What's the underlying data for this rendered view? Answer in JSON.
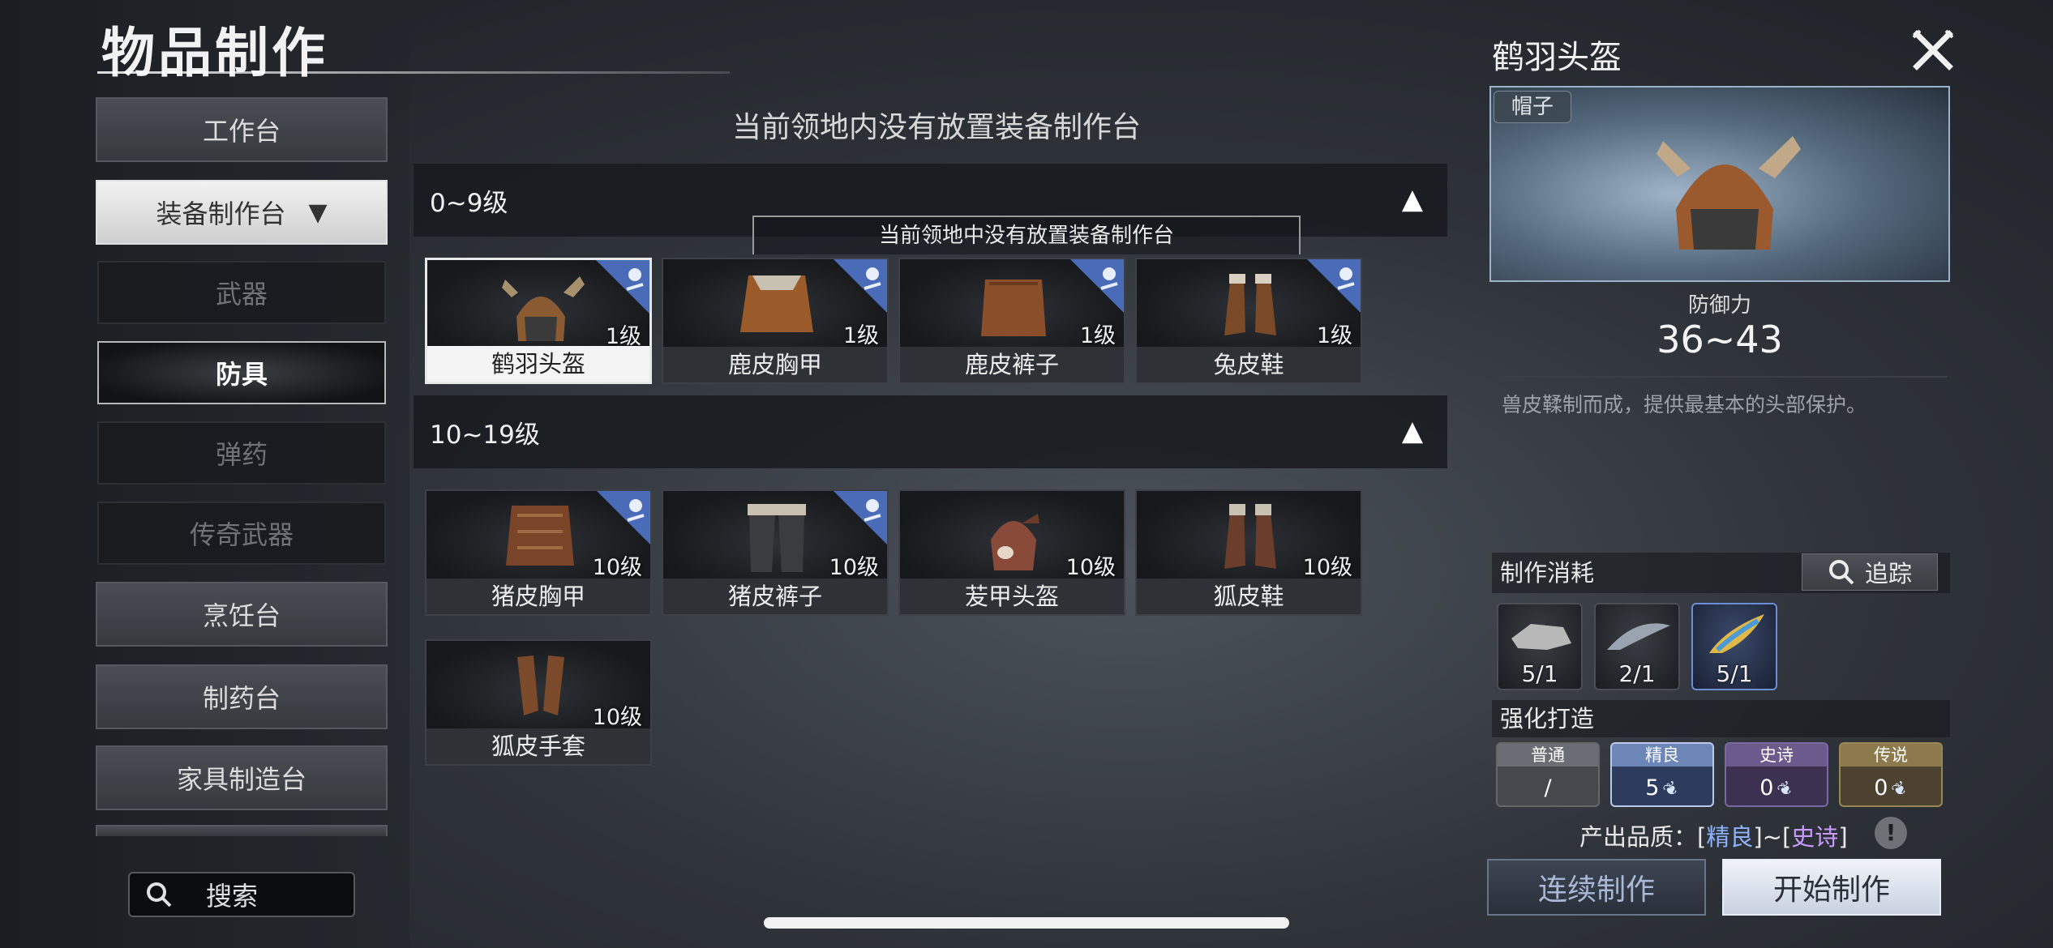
{
  "header": {
    "title": "物品制作"
  },
  "sidebar": {
    "categories": {
      "workbench": "工作台",
      "equipment_bench": "装备制作台",
      "cooking": "烹饪台",
      "pharmacy": "制药台",
      "furniture": "家具制造台"
    },
    "sub_items": {
      "weapons": "武器",
      "armor": "防具",
      "ammo": "弹药",
      "legendary": "传奇武器"
    },
    "search_label": "搜索"
  },
  "main": {
    "notice": "当前领地内没有放置装备制作台",
    "tooltip": "当前领地中没有放置装备制作台",
    "sections": [
      {
        "title": "0~9级",
        "items": [
          {
            "name": "鹤羽头盔",
            "level": "1级"
          },
          {
            "name": "鹿皮胸甲",
            "level": "1级"
          },
          {
            "name": "鹿皮裤子",
            "level": "1级"
          },
          {
            "name": "兔皮鞋",
            "level": "1级"
          }
        ]
      },
      {
        "title": "10~19级",
        "items": [
          {
            "name": "猪皮胸甲",
            "level": "10级"
          },
          {
            "name": "猪皮裤子",
            "level": "10级"
          },
          {
            "name": "苃甲头盔",
            "level": "10级"
          },
          {
            "name": "狐皮鞋",
            "level": "10级"
          },
          {
            "name": "狐皮手套",
            "level": "10级"
          }
        ]
      }
    ]
  },
  "detail": {
    "title": "鹤羽头盔",
    "type_tag": "帽子",
    "defense_label": "防御力",
    "defense_value": "36~43",
    "description": "兽皮鞣制而成，提供最基本的头部保护。",
    "materials_label": "制作消耗",
    "track_label": "追踪",
    "materials": [
      {
        "count": "5/1"
      },
      {
        "count": "2/1"
      },
      {
        "count": "5/1"
      }
    ],
    "enhance_label": "强化打造",
    "qualities": [
      {
        "name": "普通",
        "value": "/"
      },
      {
        "name": "精良",
        "value": "5"
      },
      {
        "name": "史诗",
        "value": "0"
      },
      {
        "name": "传说",
        "value": "0"
      }
    ],
    "output_prefix": "产出品质：",
    "output_open1": "[",
    "output_fine": "精良",
    "output_mid": "]~[",
    "output_epic": "史诗",
    "output_close": "]",
    "info_label": "!",
    "continue_label": "连续制作",
    "start_label": "开始制作"
  },
  "colors": {
    "accent_fine": "#8fb3ff",
    "accent_epic": "#c99bff",
    "badge_blue": "#4a6bb8"
  }
}
